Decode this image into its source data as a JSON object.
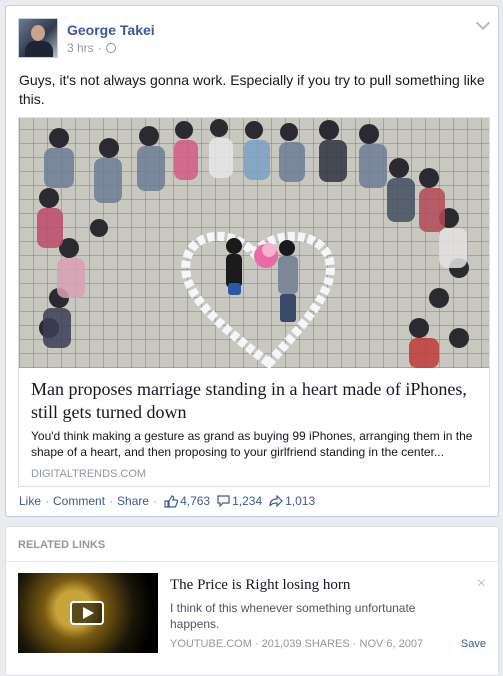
{
  "post": {
    "author": "George Takei",
    "time": "3 hrs",
    "separator": "·",
    "message": "Guys, it's not always gonna work. Especially if you try to pull something like this.",
    "link": {
      "title": "Man proposes marriage standing in a heart made of iPhones, still gets turned down",
      "description": "You'd think making a gesture as grand as buying 99 iPhones, arranging them in the shape of a heart, and then proposing to your girlfriend standing in the center...",
      "domain": "DIGITALTRENDS.COM"
    },
    "actions": {
      "like": "Like",
      "comment": "Comment",
      "share": "Share",
      "dot": "·",
      "likes_count": "4,763",
      "comments_count": "1,234",
      "shares_count": "1,013"
    }
  },
  "related": {
    "header": "RELATED LINKS",
    "item": {
      "title": "The Price is Right losing horn",
      "description": "I think of this whenever something unfortunate happens.",
      "meta": "YOUTUBE.COM · 201,039 SHARES · NOV 6, 2007",
      "save": "Save",
      "close": "×"
    }
  },
  "icons": {
    "privacy": "globe-icon",
    "options": "chevron-down-icon",
    "like": "thumbs-up-icon",
    "comment": "comment-icon",
    "share": "share-arrow-icon",
    "play": "play-icon"
  },
  "colors": {
    "link_blue": "#3b5998",
    "muted": "#9197a3",
    "text": "#141823"
  }
}
